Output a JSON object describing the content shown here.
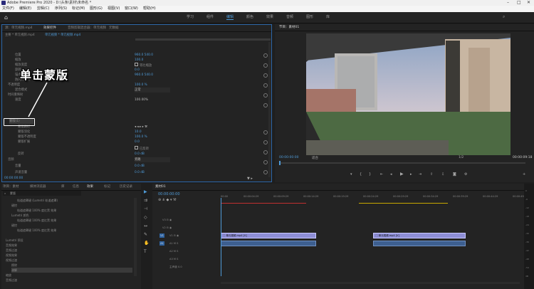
{
  "window": {
    "title": "Adobe Premiere Pro 2020 - D:\\头条\\素材\\未命名 *",
    "controls": [
      "–",
      "□",
      "✕"
    ]
  },
  "menu": [
    "文件(F)",
    "编辑(E)",
    "剪辑(C)",
    "序列(S)",
    "标记(M)",
    "图形(G)",
    "视图(V)",
    "窗口(W)",
    "帮助(H)"
  ],
  "workspaces": {
    "items": [
      "学习",
      "组件",
      "编辑",
      "颜色",
      "效果",
      "音频",
      "图形",
      "库"
    ],
    "active": 2
  },
  "effect_controls": {
    "tabs": [
      "源：单元视频.mp4",
      "效果控件",
      "音频剪辑混合器：单元视频",
      "元数据",
      "元数据"
    ],
    "active_tab": 1,
    "source": "主要 * 单元视频.mp4",
    "clip": "单元视频 * 单元视频.mp4",
    "rows": [
      "位置",
      "缩放",
      "缩放宽度",
      "旋转",
      "锚点",
      "防闪烁滤镜",
      "不透明度",
      "混合模式",
      "时间重映射",
      "速度",
      "蒙版(1)",
      "蒙版路径",
      "蒙版羽化",
      "蒙版不透明度",
      "蒙版扩展",
      "反转",
      "音频",
      "音量",
      "声道音量"
    ],
    "values": {
      "position": "960.0   540.0",
      "scale": "100.0",
      "scale_width": "100.0",
      "rotation": "0.0",
      "anchor": "960.0   540.0",
      "uniform_scale_label": "等比缩放",
      "opacity": "100.0 %",
      "blend_mode": "正常",
      "speed": "100.00%",
      "mask_feather": "10.0",
      "mask_opacity": "100.0 %",
      "mask_expand": "0.0",
      "invert_label": "已反转",
      "level": "0.0 dB",
      "volume_mode": "旁路",
      "left": "0.0 dB",
      "right": "0.0 dB"
    },
    "timecode": "00:00:00:00"
  },
  "callout": {
    "text": "单击蒙版"
  },
  "program_monitor": {
    "title": "节目：素材01",
    "timecode_left": "00:00:00:00",
    "fit": "适合",
    "quality": "完整",
    "ratio": "1/2",
    "timecode_right": "00:00:09:18"
  },
  "project": {
    "tabs": [
      "项目：素材",
      "媒体浏览器",
      "库",
      "信息",
      "效果",
      "标记",
      "历史记录"
    ],
    "active_tab": 4,
    "search_placeholder": "蒙版",
    "items": [
      "轨道遮罩键 (Lumetri 轨道遮罩)",
      "键控",
      "轨道遮罩键 100% 度红黑 效果",
      "Lumetri 颜色",
      "轨道遮罩键 100% 度红黑 效果",
      "键控",
      "轨道遮罩键 100% 度红黑 效果",
      "Lumetri 预设",
      "音频效果",
      "音频过渡",
      "视频效果",
      "视频过渡",
      "擦除",
      "溶解",
      "缩放",
      "音频过渡"
    ]
  },
  "timeline": {
    "title": "素材01",
    "timecode": "00:00:00:00",
    "ruler": [
      "00:00",
      "00:00:04:29",
      "00:00:09:29",
      "00:00:14:29",
      "00:00:19:29",
      "00:00:24:29",
      "00:00:29:29",
      "00:00:34:29",
      "00:00:39:29",
      "00:00:44:29",
      "00:00:49:29"
    ],
    "tracks_video": [
      "V3",
      "V2",
      "V1"
    ],
    "tracks_audio": [
      "A1",
      "A2",
      "A3"
    ],
    "master": "主声道",
    "master_value": "0.0",
    "clips": [
      {
        "label": "单元视频.mp4 [V]",
        "track": "V1",
        "start": 0,
        "end": 0.32
      },
      {
        "label": "单元视频.mp4 [V]",
        "track": "V1",
        "start": 0.51,
        "end": 0.82
      }
    ],
    "meter_labels": [
      "0",
      "-6",
      "-12",
      "-18",
      "-24",
      "-30",
      "-36",
      "-42",
      "-48",
      "-54",
      "dB"
    ]
  },
  "colors": {
    "accent": "#4f9bd8",
    "video_clip": "#8e8ed6",
    "audio_clip": "#3d5f90",
    "panel": "#232323",
    "playhead": "#4f9bd8"
  }
}
